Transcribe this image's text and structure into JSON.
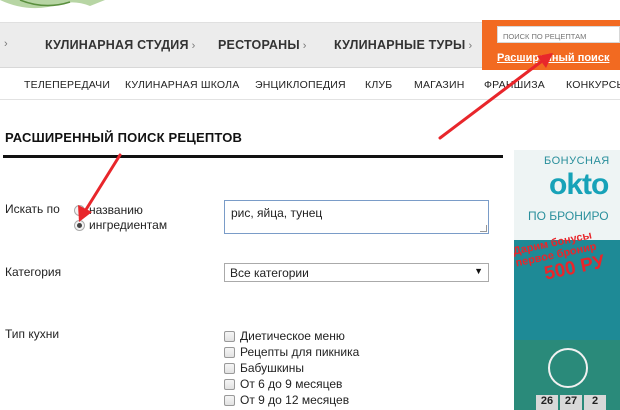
{
  "main_nav": {
    "items": [
      {
        "label": "КУЛИНАРНАЯ СТУДИЯ",
        "arrow": "›"
      },
      {
        "label": "РЕСТОРАНЫ",
        "arrow": "›"
      },
      {
        "label": "КУЛИНАРНЫЕ ТУРЫ",
        "arrow": "›"
      }
    ],
    "leading_arrow": "›"
  },
  "search": {
    "placeholder": "ПОИСК ПО РЕЦЕПТАМ",
    "advanced_link": "Расширенный поиск"
  },
  "sub_nav": {
    "items": [
      "ТЕЛЕПЕРЕДАЧИ",
      "КУЛИНАРНАЯ ШКОЛА",
      "ЭНЦИКЛОПЕДИЯ",
      "КЛУБ",
      "МАГАЗИН",
      "ФРАНШИЗА",
      "КОНКУРСЫ"
    ]
  },
  "page": {
    "title": "РАСШИРЕННЫЙ ПОИСК РЕЦЕПТОВ"
  },
  "form": {
    "search_by_label": "Искать по",
    "radio_options": [
      {
        "label": "названию",
        "checked": false
      },
      {
        "label": "ингредиентам",
        "checked": true
      }
    ],
    "ingredients_value": "рис, яйца, тунец",
    "category_label": "Категория",
    "category_value": "Все категории",
    "cuisine_label": "Тип кухни",
    "cuisine_options": [
      "Диетическое меню",
      "Рецепты для пикника",
      "Бабушкины",
      "От 6 до 9 месяцев",
      "От 9 до 12 месяцев"
    ]
  },
  "ad": {
    "line1": "БОНУСНАЯ",
    "logo": "okto",
    "line2": "ПО БРОНИРО",
    "promo1": "Дарим бонусы",
    "promo2": "первое бронир",
    "promo3": "500 РУ",
    "days": [
      "26",
      "27",
      "2"
    ]
  },
  "colors": {
    "accent_orange": "#f26a21",
    "annotation_red": "#e8262b"
  }
}
